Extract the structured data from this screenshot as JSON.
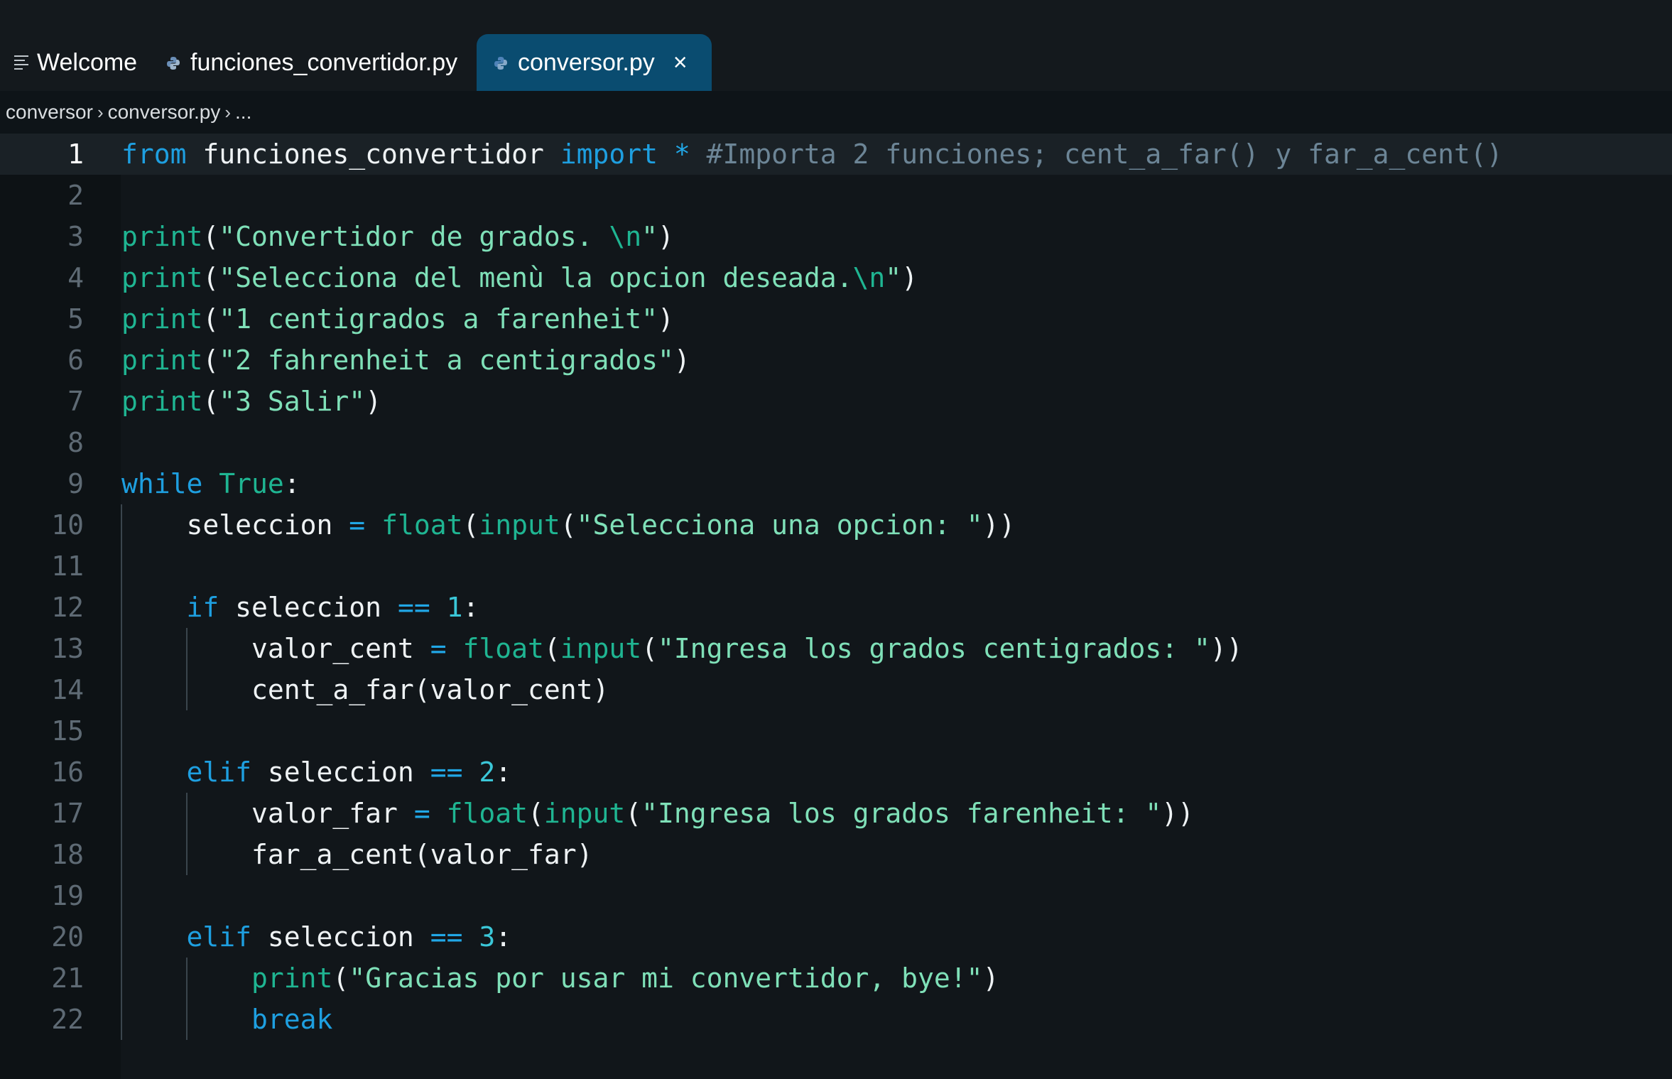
{
  "tabs": [
    {
      "label": "Welcome",
      "icon": "menu-icon",
      "active": false
    },
    {
      "label": "funciones_convertidor.py",
      "icon": "python-file-icon",
      "active": false
    },
    {
      "label": "conversor.py",
      "icon": "python-file-icon",
      "active": true,
      "close_symbol": "×"
    }
  ],
  "breadcrumb": {
    "folder": "conversor",
    "file": "conversor.py",
    "symbol": "...",
    "separator": "›"
  },
  "editor": {
    "current_line": 1,
    "lines": [
      {
        "number": "1",
        "tokens": [
          [
            "k",
            "from"
          ],
          [
            "p",
            " funciones_convertidor "
          ],
          [
            "k",
            "import"
          ],
          [
            "o",
            " * "
          ],
          [
            "c",
            "#Importa 2 funciones; cent_a_far() y far_a_cent()"
          ]
        ]
      },
      {
        "number": "2",
        "tokens": []
      },
      {
        "number": "3",
        "tokens": [
          [
            "b",
            "print"
          ],
          [
            "p",
            "("
          ],
          [
            "s",
            "\"Convertidor de grados. "
          ],
          [
            "e",
            "\\n"
          ],
          [
            "s",
            "\""
          ],
          [
            "p",
            ")"
          ]
        ]
      },
      {
        "number": "4",
        "tokens": [
          [
            "b",
            "print"
          ],
          [
            "p",
            "("
          ],
          [
            "s",
            "\"Selecciona del menù la opcion deseada."
          ],
          [
            "e",
            "\\n"
          ],
          [
            "s",
            "\""
          ],
          [
            "p",
            ")"
          ]
        ]
      },
      {
        "number": "5",
        "tokens": [
          [
            "b",
            "print"
          ],
          [
            "p",
            "("
          ],
          [
            "s",
            "\"1 centigrados a farenheit\""
          ],
          [
            "p",
            ")"
          ]
        ]
      },
      {
        "number": "6",
        "tokens": [
          [
            "b",
            "print"
          ],
          [
            "p",
            "("
          ],
          [
            "s",
            "\"2 fahrenheit a centigrados\""
          ],
          [
            "p",
            ")"
          ]
        ]
      },
      {
        "number": "7",
        "tokens": [
          [
            "b",
            "print"
          ],
          [
            "p",
            "("
          ],
          [
            "s",
            "\"3 Salir\""
          ],
          [
            "p",
            ")"
          ]
        ]
      },
      {
        "number": "8",
        "tokens": []
      },
      {
        "number": "9",
        "tokens": [
          [
            "k",
            "while"
          ],
          [
            "p",
            " "
          ],
          [
            "b",
            "True"
          ],
          [
            "p",
            ":"
          ]
        ]
      },
      {
        "number": "10",
        "tokens": [
          [
            "p",
            "    seleccion "
          ],
          [
            "o",
            "="
          ],
          [
            "p",
            " "
          ],
          [
            "b",
            "float"
          ],
          [
            "p",
            "("
          ],
          [
            "b",
            "input"
          ],
          [
            "p",
            "("
          ],
          [
            "s",
            "\"Selecciona una opcion: \""
          ],
          [
            "p",
            "))"
          ]
        ]
      },
      {
        "number": "11",
        "tokens": []
      },
      {
        "number": "12",
        "tokens": [
          [
            "p",
            "    "
          ],
          [
            "k",
            "if"
          ],
          [
            "p",
            " seleccion "
          ],
          [
            "o",
            "=="
          ],
          [
            "p",
            " "
          ],
          [
            "n",
            "1"
          ],
          [
            "p",
            ":"
          ]
        ]
      },
      {
        "number": "13",
        "tokens": [
          [
            "p",
            "        valor_cent "
          ],
          [
            "o",
            "="
          ],
          [
            "p",
            " "
          ],
          [
            "b",
            "float"
          ],
          [
            "p",
            "("
          ],
          [
            "b",
            "input"
          ],
          [
            "p",
            "("
          ],
          [
            "s",
            "\"Ingresa los grados centigrados: \""
          ],
          [
            "p",
            "))"
          ]
        ]
      },
      {
        "number": "14",
        "tokens": [
          [
            "p",
            "        cent_a_far(valor_cent)"
          ]
        ]
      },
      {
        "number": "15",
        "tokens": []
      },
      {
        "number": "16",
        "tokens": [
          [
            "p",
            "    "
          ],
          [
            "k",
            "elif"
          ],
          [
            "p",
            " seleccion "
          ],
          [
            "o",
            "=="
          ],
          [
            "p",
            " "
          ],
          [
            "n",
            "2"
          ],
          [
            "p",
            ":"
          ]
        ]
      },
      {
        "number": "17",
        "tokens": [
          [
            "p",
            "        valor_far "
          ],
          [
            "o",
            "="
          ],
          [
            "p",
            " "
          ],
          [
            "b",
            "float"
          ],
          [
            "p",
            "("
          ],
          [
            "b",
            "input"
          ],
          [
            "p",
            "("
          ],
          [
            "s",
            "\"Ingresa los grados farenheit: \""
          ],
          [
            "p",
            "))"
          ]
        ]
      },
      {
        "number": "18",
        "tokens": [
          [
            "p",
            "        far_a_cent(valor_far)"
          ]
        ]
      },
      {
        "number": "19",
        "tokens": []
      },
      {
        "number": "20",
        "tokens": [
          [
            "p",
            "    "
          ],
          [
            "k",
            "elif"
          ],
          [
            "p",
            " seleccion "
          ],
          [
            "o",
            "=="
          ],
          [
            "p",
            " "
          ],
          [
            "n",
            "3"
          ],
          [
            "p",
            ":"
          ]
        ]
      },
      {
        "number": "21",
        "tokens": [
          [
            "p",
            "        "
          ],
          [
            "b",
            "print"
          ],
          [
            "p",
            "("
          ],
          [
            "s",
            "\"Gracias por usar mi convertidor, bye!\""
          ],
          [
            "p",
            ")"
          ]
        ]
      },
      {
        "number": "22",
        "tokens": [
          [
            "p",
            "        "
          ],
          [
            "k",
            "break"
          ]
        ]
      }
    ]
  },
  "colors": {
    "background": "#0e1418",
    "tab_active": "#0a4c70",
    "keyword": "#1e9fe0",
    "builtin": "#1fb592",
    "string": "#7fe0b8",
    "comment": "#6c8596",
    "number": "#3bc7d8"
  }
}
